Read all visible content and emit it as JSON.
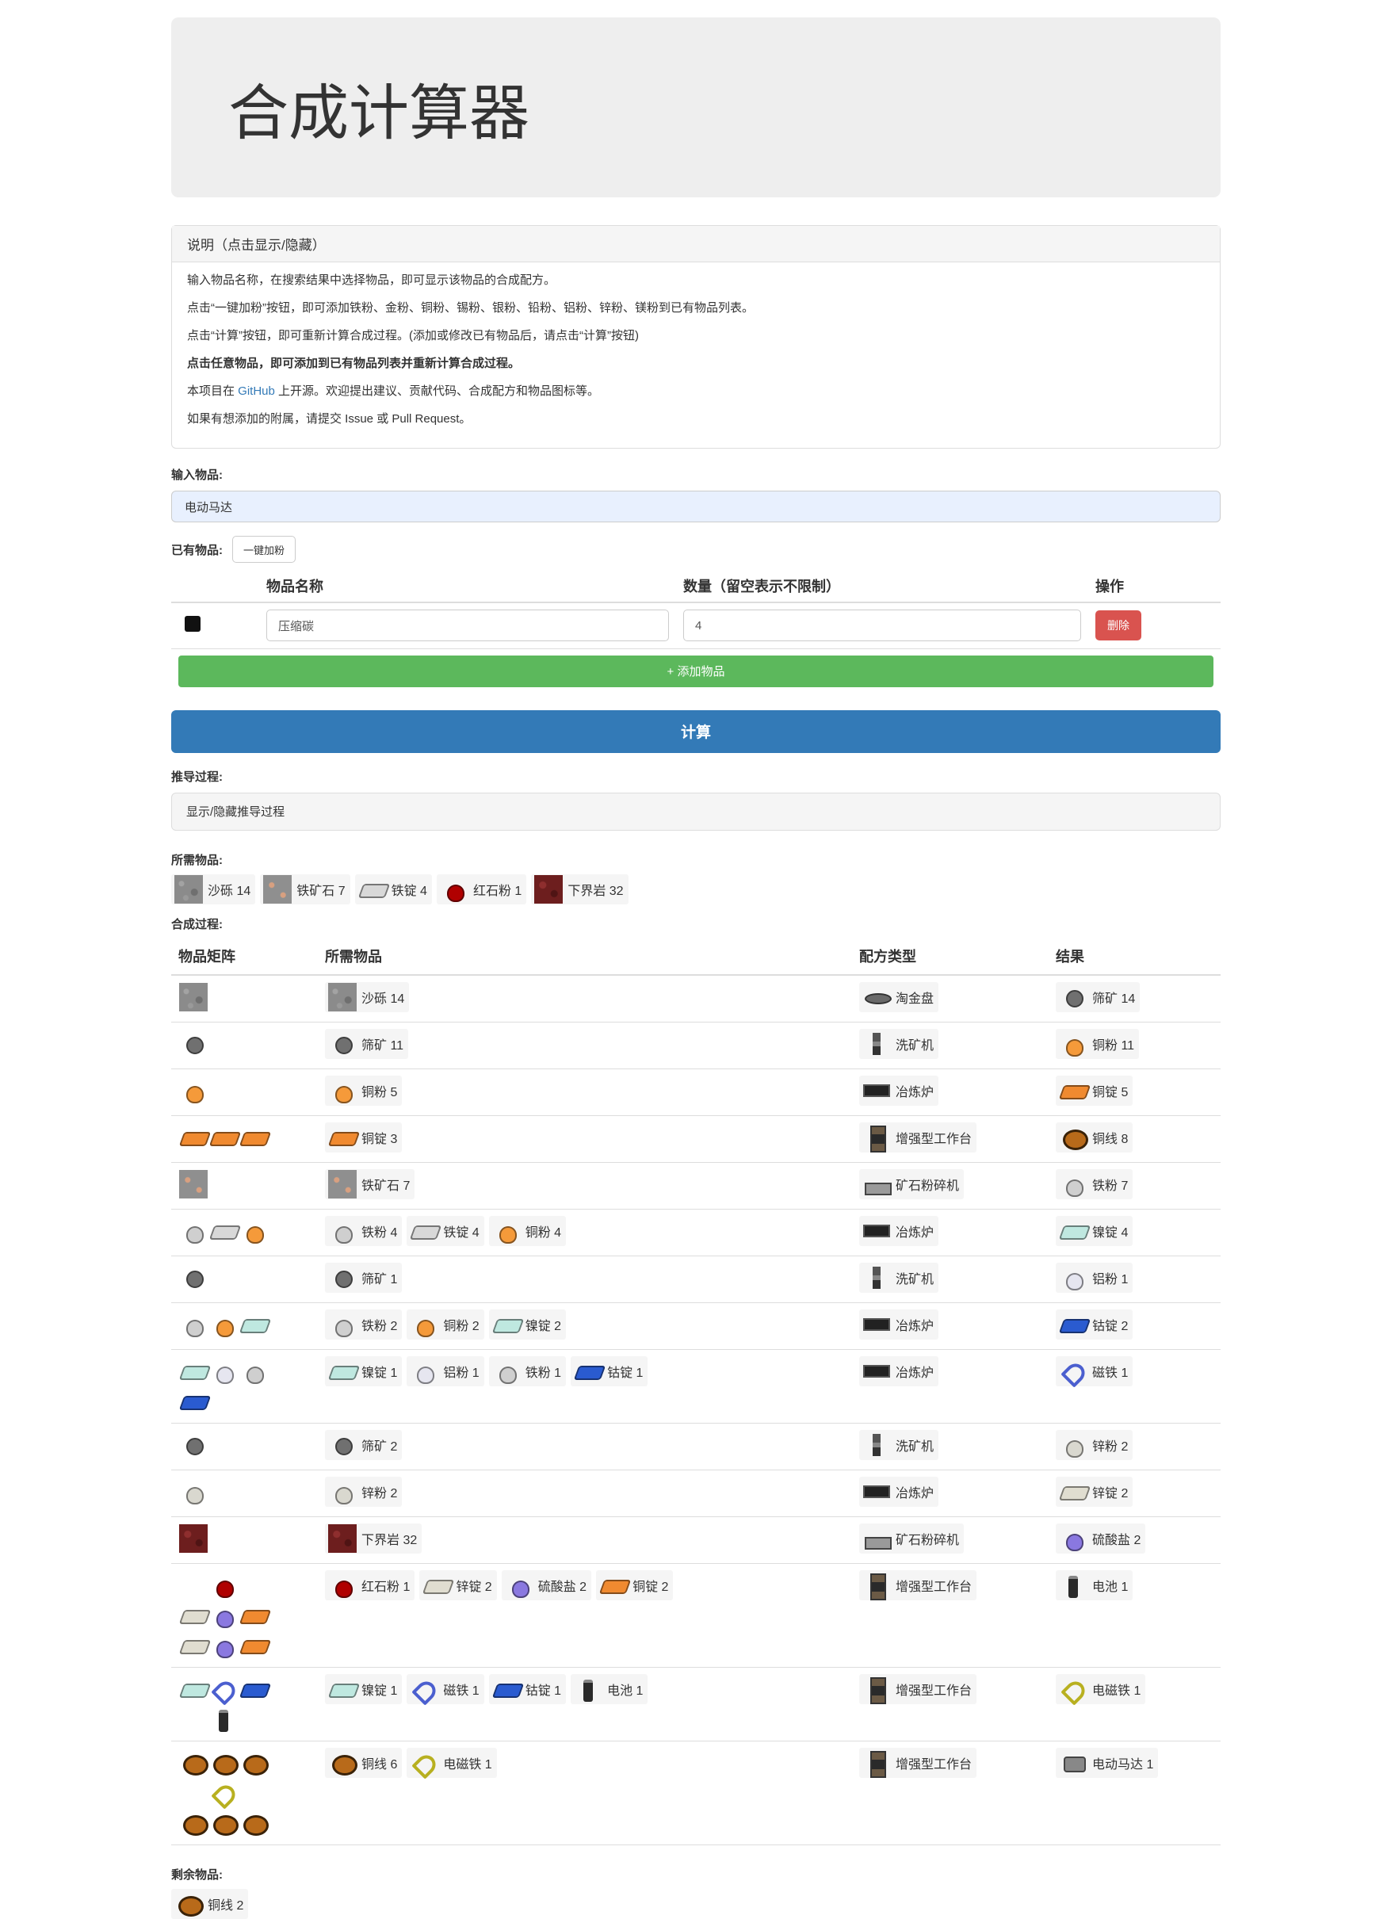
{
  "title": "合成计算器",
  "instructions": {
    "heading": "说明（点击显示/隐藏）",
    "lines": [
      "输入物品名称，在搜索结果中选择物品，即可显示该物品的合成配方。",
      "点击“一键加粉”按钮，即可添加铁粉、金粉、铜粉、锡粉、银粉、铅粉、铝粉、锌粉、镁粉到已有物品列表。",
      "点击“计算”按钮，即可重新计算合成过程。(添加或修改已有物品后，请点击“计算”按钮)",
      "点击任意物品，即可添加到已有物品列表并重新计算合成过程。"
    ],
    "github_prefix": "本项目在 ",
    "github_link": "GitHub",
    "github_suffix": " 上开源。欢迎提出建议、贡献代码、合成配方和物品图标等。",
    "last_line": "如果有想添加的附属，请提交 Issue 或 Pull Request。"
  },
  "input": {
    "label": "输入物品:",
    "value": "电动马达"
  },
  "owned": {
    "label": "已有物品:",
    "add_dust_button": "一键加粉",
    "headers": {
      "name": "物品名称",
      "qty": "数量（留空表示不限制）",
      "action": "操作"
    },
    "rows": [
      {
        "icon": "carbon",
        "name": "压缩碳",
        "qty": "4",
        "delete": "删除"
      }
    ],
    "add_button": "+ 添加物品"
  },
  "compute_button": "计算",
  "derive": {
    "label": "推导过程:",
    "toggle": "显示/隐藏推导过程"
  },
  "needed": {
    "label": "所需物品:",
    "items": [
      {
        "icon": "gravel",
        "text": "沙砾 14"
      },
      {
        "icon": "iron-ore",
        "text": "铁矿石 7"
      },
      {
        "icon": "ingot ingot-iron",
        "text": "铁锭 4"
      },
      {
        "icon": "dust dust-red",
        "text": "红石粉 1"
      },
      {
        "icon": "netherrack",
        "text": "下界岩 32"
      }
    ]
  },
  "process": {
    "label": "合成过程:",
    "headers": {
      "matrix": "物品矩阵",
      "items": "所需物品",
      "type": "配方类型",
      "result": "结果"
    },
    "rows": [
      {
        "matrix": [
          "gravel"
        ],
        "items": [
          {
            "icon": "gravel",
            "text": "沙砾 14"
          }
        ],
        "type": {
          "icon": "pan",
          "text": "淘金盘"
        },
        "result": {
          "icon": "crushed",
          "text": "筛矿 14"
        }
      },
      {
        "matrix": [
          "crushed"
        ],
        "items": [
          {
            "icon": "crushed",
            "text": "筛矿 11"
          }
        ],
        "type": {
          "icon": "washer",
          "text": "洗矿机"
        },
        "result": {
          "icon": "dust dust-copper",
          "text": "铜粉 11"
        }
      },
      {
        "matrix": [
          "dust dust-copper"
        ],
        "items": [
          {
            "icon": "dust dust-copper",
            "text": "铜粉 5"
          }
        ],
        "type": {
          "icon": "smelter",
          "text": "冶炼炉"
        },
        "result": {
          "icon": "ingot ingot-copper",
          "text": "铜锭 5"
        }
      },
      {
        "matrix": [
          "ingot ingot-copper",
          "ingot ingot-copper",
          "ingot ingot-copper"
        ],
        "items": [
          {
            "icon": "ingot ingot-copper",
            "text": "铜锭 3"
          }
        ],
        "type": {
          "icon": "workbench",
          "text": "增强型工作台"
        },
        "result": {
          "icon": "copper-wire",
          "text": "铜线 8"
        }
      },
      {
        "matrix": [
          "iron-ore"
        ],
        "items": [
          {
            "icon": "iron-ore",
            "text": "铁矿石 7"
          }
        ],
        "type": {
          "icon": "crusher",
          "text": "矿石粉碎机"
        },
        "result": {
          "icon": "dust dust-iron",
          "text": "铁粉 7"
        }
      },
      {
        "matrix": [
          "dust dust-iron",
          "ingot ingot-iron",
          "dust dust-copper"
        ],
        "items": [
          {
            "icon": "dust dust-iron",
            "text": "铁粉 4"
          },
          {
            "icon": "ingot ingot-iron",
            "text": "铁锭 4"
          },
          {
            "icon": "dust dust-copper",
            "text": "铜粉 4"
          }
        ],
        "type": {
          "icon": "smelter",
          "text": "冶炼炉"
        },
        "result": {
          "icon": "ingot ingot-nickel",
          "text": "镍锭 4"
        }
      },
      {
        "matrix": [
          "crushed"
        ],
        "items": [
          {
            "icon": "crushed",
            "text": "筛矿 1"
          }
        ],
        "type": {
          "icon": "washer",
          "text": "洗矿机"
        },
        "result": {
          "icon": "dust dust-alu",
          "text": "铝粉 1"
        }
      },
      {
        "matrix": [
          "dust dust-iron",
          "dust dust-copper",
          "ingot ingot-nickel"
        ],
        "items": [
          {
            "icon": "dust dust-iron",
            "text": "铁粉 2"
          },
          {
            "icon": "dust dust-copper",
            "text": "铜粉 2"
          },
          {
            "icon": "ingot ingot-nickel",
            "text": "镍锭 2"
          }
        ],
        "type": {
          "icon": "smelter",
          "text": "冶炼炉"
        },
        "result": {
          "icon": "ingot ingot-cobalt",
          "text": "钴锭 2"
        }
      },
      {
        "matrix": [
          "ingot ingot-nickel",
          "dust dust-alu",
          "dust dust-iron",
          "ingot ingot-cobalt"
        ],
        "items": [
          {
            "icon": "ingot ingot-nickel",
            "text": "镍锭 1"
          },
          {
            "icon": "dust dust-alu",
            "text": "铝粉 1"
          },
          {
            "icon": "dust dust-iron",
            "text": "铁粉 1"
          },
          {
            "icon": "ingot ingot-cobalt",
            "text": "钴锭 1"
          }
        ],
        "type": {
          "icon": "smelter",
          "text": "冶炼炉"
        },
        "result": {
          "icon": "magnet",
          "text": "磁铁 1"
        }
      },
      {
        "matrix": [
          "crushed"
        ],
        "items": [
          {
            "icon": "crushed",
            "text": "筛矿 2"
          }
        ],
        "type": {
          "icon": "washer",
          "text": "洗矿机"
        },
        "result": {
          "icon": "dust dust-zinc",
          "text": "锌粉 2"
        }
      },
      {
        "matrix": [
          "dust dust-zinc"
        ],
        "items": [
          {
            "icon": "dust dust-zinc",
            "text": "锌粉 2"
          }
        ],
        "type": {
          "icon": "smelter",
          "text": "冶炼炉"
        },
        "result": {
          "icon": "ingot ingot-tin",
          "text": "锌锭 2"
        }
      },
      {
        "matrix": [
          "netherrack"
        ],
        "items": [
          {
            "icon": "netherrack",
            "text": "下界岩 32"
          }
        ],
        "type": {
          "icon": "crusher",
          "text": "矿石粉碎机"
        },
        "result": {
          "icon": "dust dust-sulfate",
          "text": "硫酸盐 2"
        }
      },
      {
        "matrix": [
          "",
          "dust dust-red",
          "",
          "ingot ingot-tin",
          "dust dust-sulfate",
          "ingot ingot-copper",
          "ingot ingot-tin",
          "dust dust-sulfate",
          "ingot ingot-copper"
        ],
        "items": [
          {
            "icon": "dust dust-red",
            "text": "红石粉 1"
          },
          {
            "icon": "ingot ingot-tin",
            "text": "锌锭 2"
          },
          {
            "icon": "dust dust-sulfate",
            "text": "硫酸盐 2"
          },
          {
            "icon": "ingot ingot-copper",
            "text": "铜锭 2"
          }
        ],
        "type": {
          "icon": "workbench",
          "text": "增强型工作台"
        },
        "result": {
          "icon": "battery",
          "text": "电池 1"
        }
      },
      {
        "matrix": [
          "ingot ingot-nickel",
          "magnet",
          "ingot ingot-cobalt",
          "",
          "battery",
          ""
        ],
        "items": [
          {
            "icon": "ingot ingot-nickel",
            "text": "镍锭 1"
          },
          {
            "icon": "magnet",
            "text": "磁铁 1"
          },
          {
            "icon": "ingot ingot-cobalt",
            "text": "钴锭 1"
          },
          {
            "icon": "battery",
            "text": "电池 1"
          }
        ],
        "type": {
          "icon": "workbench",
          "text": "增强型工作台"
        },
        "result": {
          "icon": "emagnet",
          "text": "电磁铁 1"
        }
      },
      {
        "matrix": [
          "copper-wire",
          "copper-wire",
          "copper-wire",
          "",
          "emagnet",
          "",
          "copper-wire",
          "copper-wire",
          "copper-wire"
        ],
        "items": [
          {
            "icon": "copper-wire",
            "text": "铜线 6"
          },
          {
            "icon": "emagnet",
            "text": "电磁铁 1"
          }
        ],
        "type": {
          "icon": "workbench",
          "text": "增强型工作台"
        },
        "result": {
          "icon": "motor",
          "text": "电动马达 1"
        }
      }
    ]
  },
  "remain": {
    "label": "剩余物品:",
    "items": [
      {
        "icon": "copper-wire",
        "text": "铜线 2"
      }
    ]
  }
}
